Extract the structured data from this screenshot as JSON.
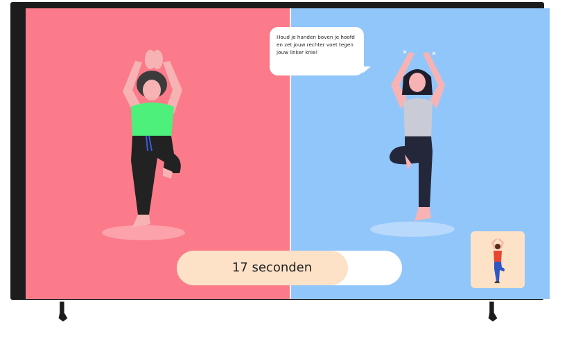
{
  "instruction": {
    "lines": [
      "Houd je handen boven je hoofd",
      "en zet jouw rechter voet tegen",
      "jouw linker knie!"
    ]
  },
  "timer": {
    "label": "17 seconden",
    "progress": 0.76
  },
  "colors": {
    "left_pane": "#fb7b8a",
    "right_pane": "#91c6fb",
    "timer_fill": "#fde2c8",
    "thumbnail_bg": "#fde2c8"
  },
  "icons": {
    "left_figure": "user-tree-pose-figure",
    "right_figure": "instructor-tree-pose-figure",
    "thumbnail": "pose-thumbnail-icon"
  }
}
